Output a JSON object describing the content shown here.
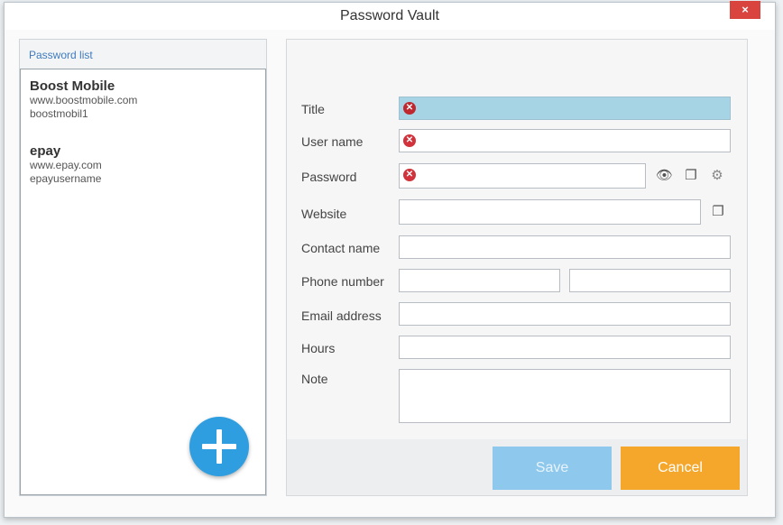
{
  "window": {
    "title": "Password Vault",
    "close_label": "×"
  },
  "left": {
    "header": "Password list",
    "entries": [
      {
        "title": "Boost Mobile",
        "url": "www.boostmobile.com",
        "username": "boostmobil1"
      },
      {
        "title": "epay",
        "url": "www.epay.com",
        "username": "epayusername"
      }
    ],
    "add_icon": "plus-icon"
  },
  "form": {
    "labels": {
      "title": "Title",
      "username": "User name",
      "password": "Password",
      "website": "Website",
      "contact": "Contact name",
      "phone": "Phone number",
      "email": "Email address",
      "hours": "Hours",
      "note": "Note"
    },
    "error_glyph": "✕",
    "icons": {
      "show_password": "👁",
      "copy": "❐",
      "settings": "⚙"
    }
  },
  "buttons": {
    "save": "Save",
    "cancel": "Cancel"
  },
  "colors": {
    "accent": "#2e9ee0",
    "save": "#8ec8ec",
    "cancel": "#f4a72a",
    "error": "#d1323b",
    "close": "#d9443f"
  }
}
